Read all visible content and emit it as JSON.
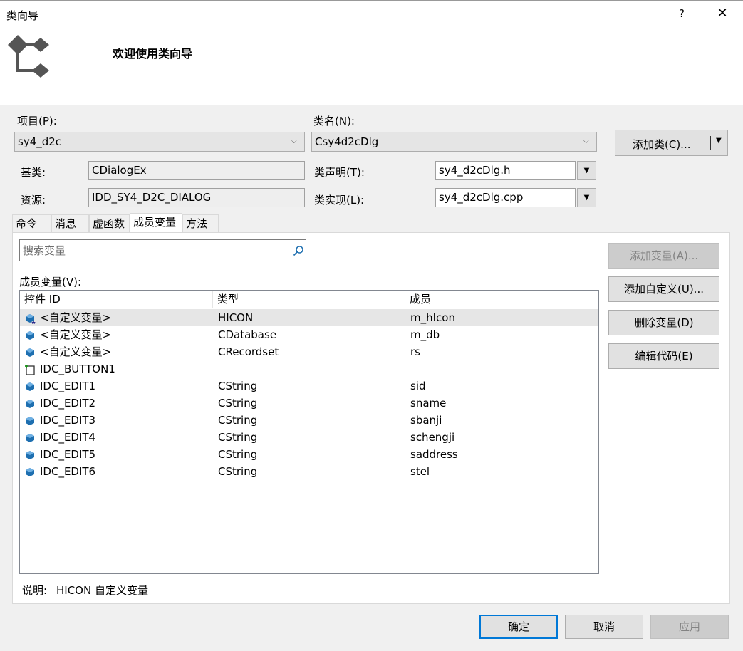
{
  "window": {
    "title": "类向导",
    "help": "?",
    "close": "✕"
  },
  "banner": {
    "title": "欢迎使用类向导"
  },
  "form": {
    "project_label": "项目(P):",
    "project_value": "sy4_d2c",
    "classname_label": "类名(N):",
    "classname_value": "Csy4d2cDlg",
    "add_class_button": "添加类(C)...",
    "base_label": "基类:",
    "base_value": "CDialogEx",
    "resource_label": "资源:",
    "resource_value": "IDD_SY4_D2C_DIALOG",
    "decl_label": "类声明(T):",
    "decl_value": "sy4_d2cDlg.h",
    "impl_label": "类实现(L):",
    "impl_value": "sy4_d2cDlg.cpp"
  },
  "tabs": [
    "命令",
    "消息",
    "虚函数",
    "成员变量",
    "方法"
  ],
  "active_tab": "成员变量",
  "search": {
    "placeholder": "搜索变量"
  },
  "members": {
    "label": "成员变量(V):",
    "columns": [
      "控件 ID",
      "类型",
      "成员"
    ],
    "rows": [
      {
        "icon": "custom-variable-icon",
        "id": "<自定义变量>",
        "type": "HICON",
        "member": "m_hIcon",
        "selected": true
      },
      {
        "icon": "variable-icon",
        "id": "<自定义变量>",
        "type": "CDatabase",
        "member": "m_db"
      },
      {
        "icon": "variable-icon",
        "id": "<自定义变量>",
        "type": "CRecordset",
        "member": "rs"
      },
      {
        "icon": "button-control-icon",
        "id": "IDC_BUTTON1",
        "type": "",
        "member": ""
      },
      {
        "icon": "variable-icon",
        "id": "IDC_EDIT1",
        "type": "CString",
        "member": "sid"
      },
      {
        "icon": "variable-icon",
        "id": "IDC_EDIT2",
        "type": "CString",
        "member": "sname"
      },
      {
        "icon": "variable-icon",
        "id": "IDC_EDIT3",
        "type": "CString",
        "member": "sbanji"
      },
      {
        "icon": "variable-icon",
        "id": "IDC_EDIT4",
        "type": "CString",
        "member": "schengji"
      },
      {
        "icon": "variable-icon",
        "id": "IDC_EDIT5",
        "type": "CString",
        "member": "saddress"
      },
      {
        "icon": "variable-icon",
        "id": "IDC_EDIT6",
        "type": "CString",
        "member": "stel"
      }
    ]
  },
  "side_buttons": {
    "add_variable": "添加变量(A)...",
    "add_custom": "添加自定义(U)...",
    "delete_variable": "删除变量(D)",
    "edit_code": "编辑代码(E)"
  },
  "description": {
    "label": "说明:",
    "text": "HICON 自定义变量"
  },
  "footer": {
    "ok": "确定",
    "cancel": "取消",
    "apply": "应用"
  },
  "colors": {
    "accent": "#0078d7",
    "variable_icon": "#1e6fb0"
  }
}
